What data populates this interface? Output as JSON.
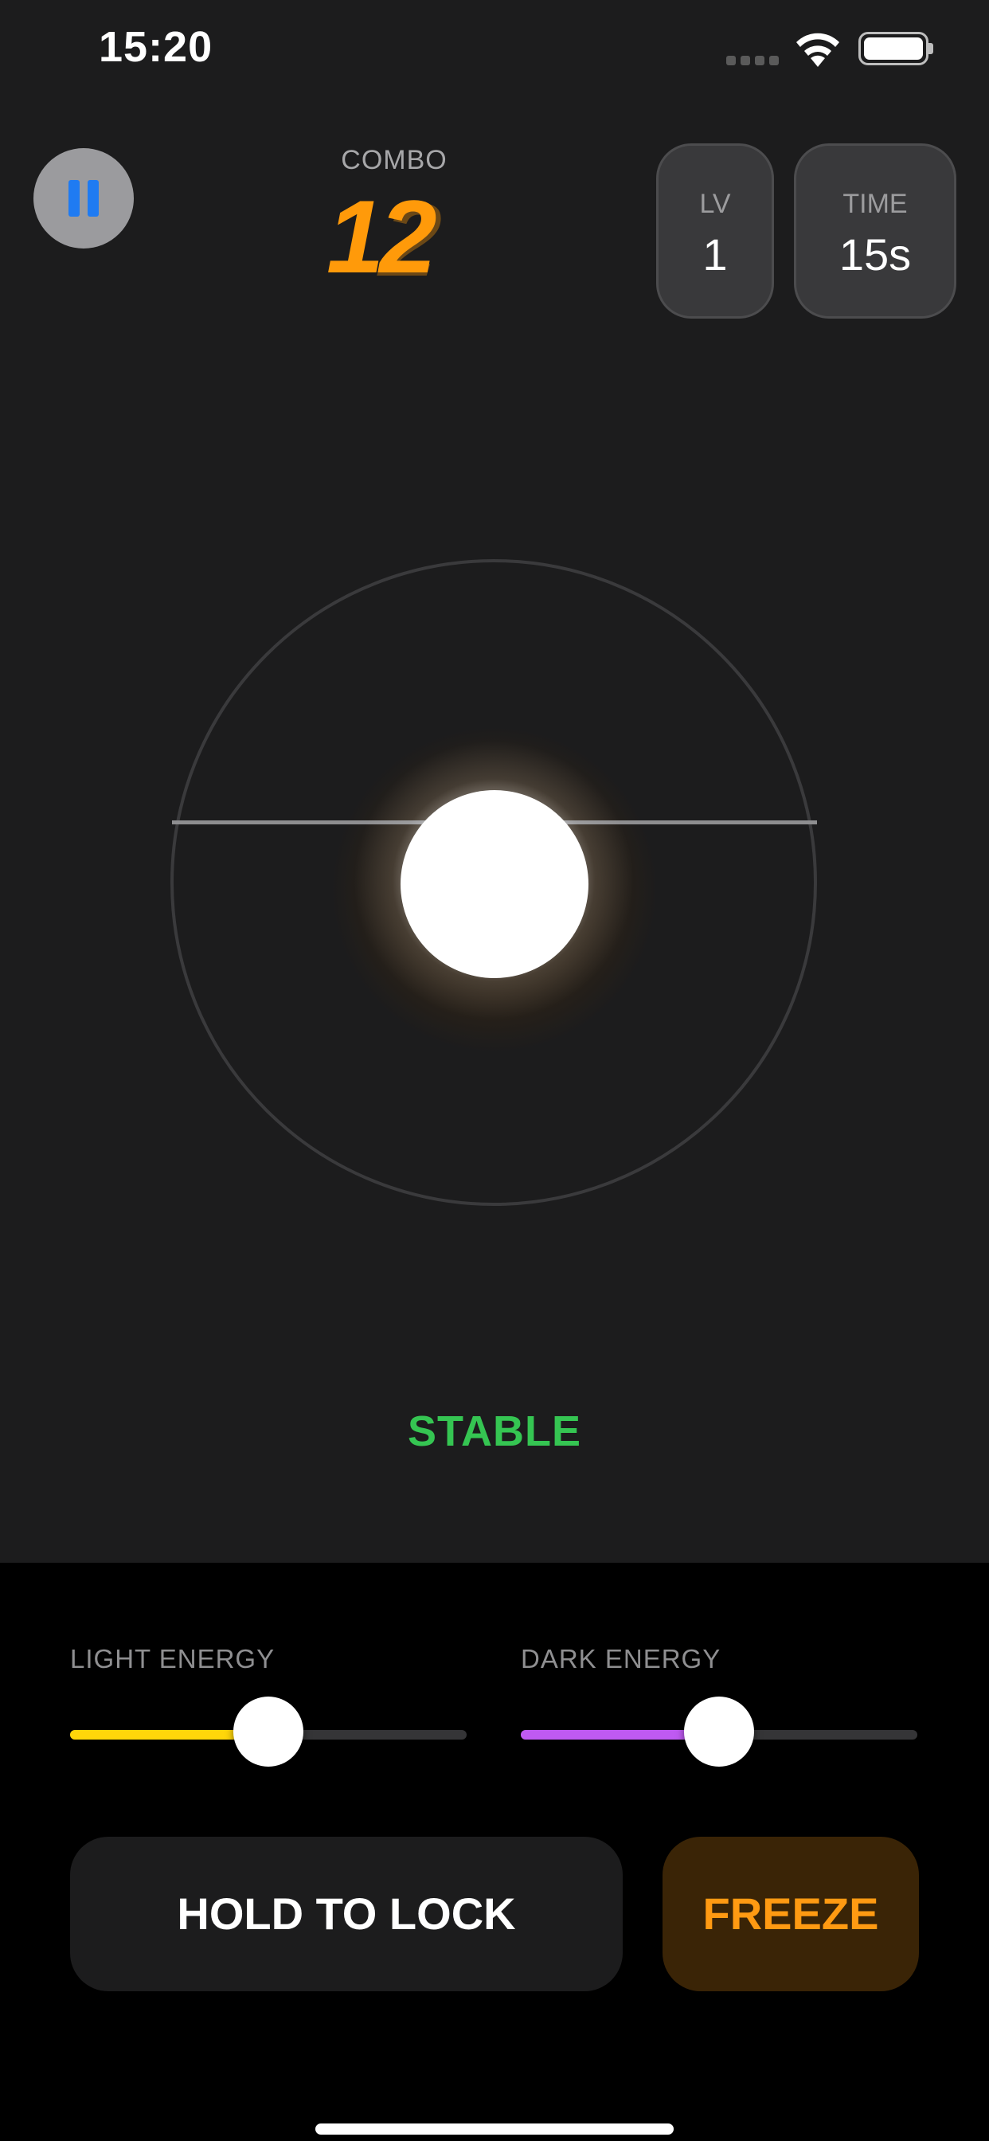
{
  "status_bar": {
    "time": "15:20"
  },
  "hud": {
    "combo_label": "COMBO",
    "combo_value": "12",
    "level": {
      "label": "LV",
      "value": "1"
    },
    "time": {
      "label": "TIME",
      "value": "15s"
    }
  },
  "arena": {
    "state": "STABLE",
    "state_color": "#35c552"
  },
  "controls": {
    "light_energy": {
      "label": "LIGHT ENERGY",
      "level": 0.5,
      "color": "#ffd60a"
    },
    "dark_energy": {
      "label": "DARK ENERGY",
      "level": 0.5,
      "color": "#bf5af2"
    },
    "hold_button": "HOLD TO LOCK",
    "freeze_button": "FREEZE"
  },
  "colors": {
    "accent_orange": "#ff9a0a",
    "pause_icon": "#1f7bf2"
  }
}
